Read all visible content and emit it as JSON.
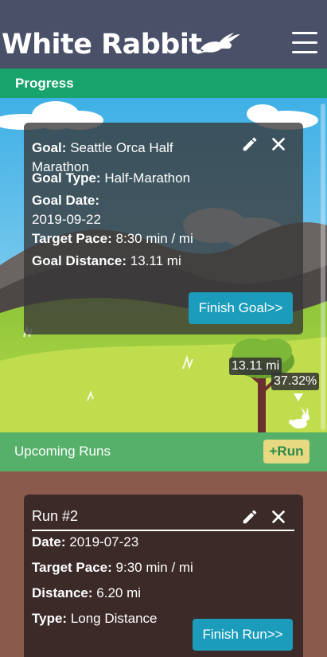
{
  "header": {
    "app_title": "White Rabbit",
    "logo_icon": "rabbit-logo-icon",
    "menu_icon": "hamburger-menu-icon"
  },
  "progress": {
    "label": "Progress",
    "goal": {
      "goal_label": "Goal:",
      "goal_value": "Seattle Orca Half Marathon",
      "type_label": "Goal Type:",
      "type_value": "Half-Marathon",
      "date_label": "Goal Date:",
      "date_value": "2019-09-22",
      "pace_label": "Target Pace:",
      "pace_value": "8:30 min / mi",
      "distance_label": "Goal Distance:",
      "distance_value": "13.11 mi",
      "finish_button": "Finish Goal>>",
      "edit_icon": "pencil-icon",
      "close_icon": "close-icon"
    },
    "track": {
      "distance_tag": "13.11 mi",
      "percent_tag": "37.32%",
      "percent_value": 37.32
    }
  },
  "upcoming": {
    "label": "Upcoming Runs",
    "add_button": "+Run",
    "runs": [
      {
        "title": "Run #2",
        "date_label": "Date:",
        "date_value": "2019-07-23",
        "pace_label": "Target Pace:",
        "pace_value": "9:30 min / mi",
        "distance_label": "Distance:",
        "distance_value": "6.20 mi",
        "type_label": "Type:",
        "type_value": "Long Distance",
        "finish_button": "Finish Run>>"
      }
    ]
  },
  "colors": {
    "header": "#4a5068",
    "progress_bar": "#18a26c",
    "runs_bar": "#56b06a",
    "button_teal": "#1b9cbb",
    "add_run_bg": "#e6d982",
    "runs_bg": "#8a5b4c"
  }
}
